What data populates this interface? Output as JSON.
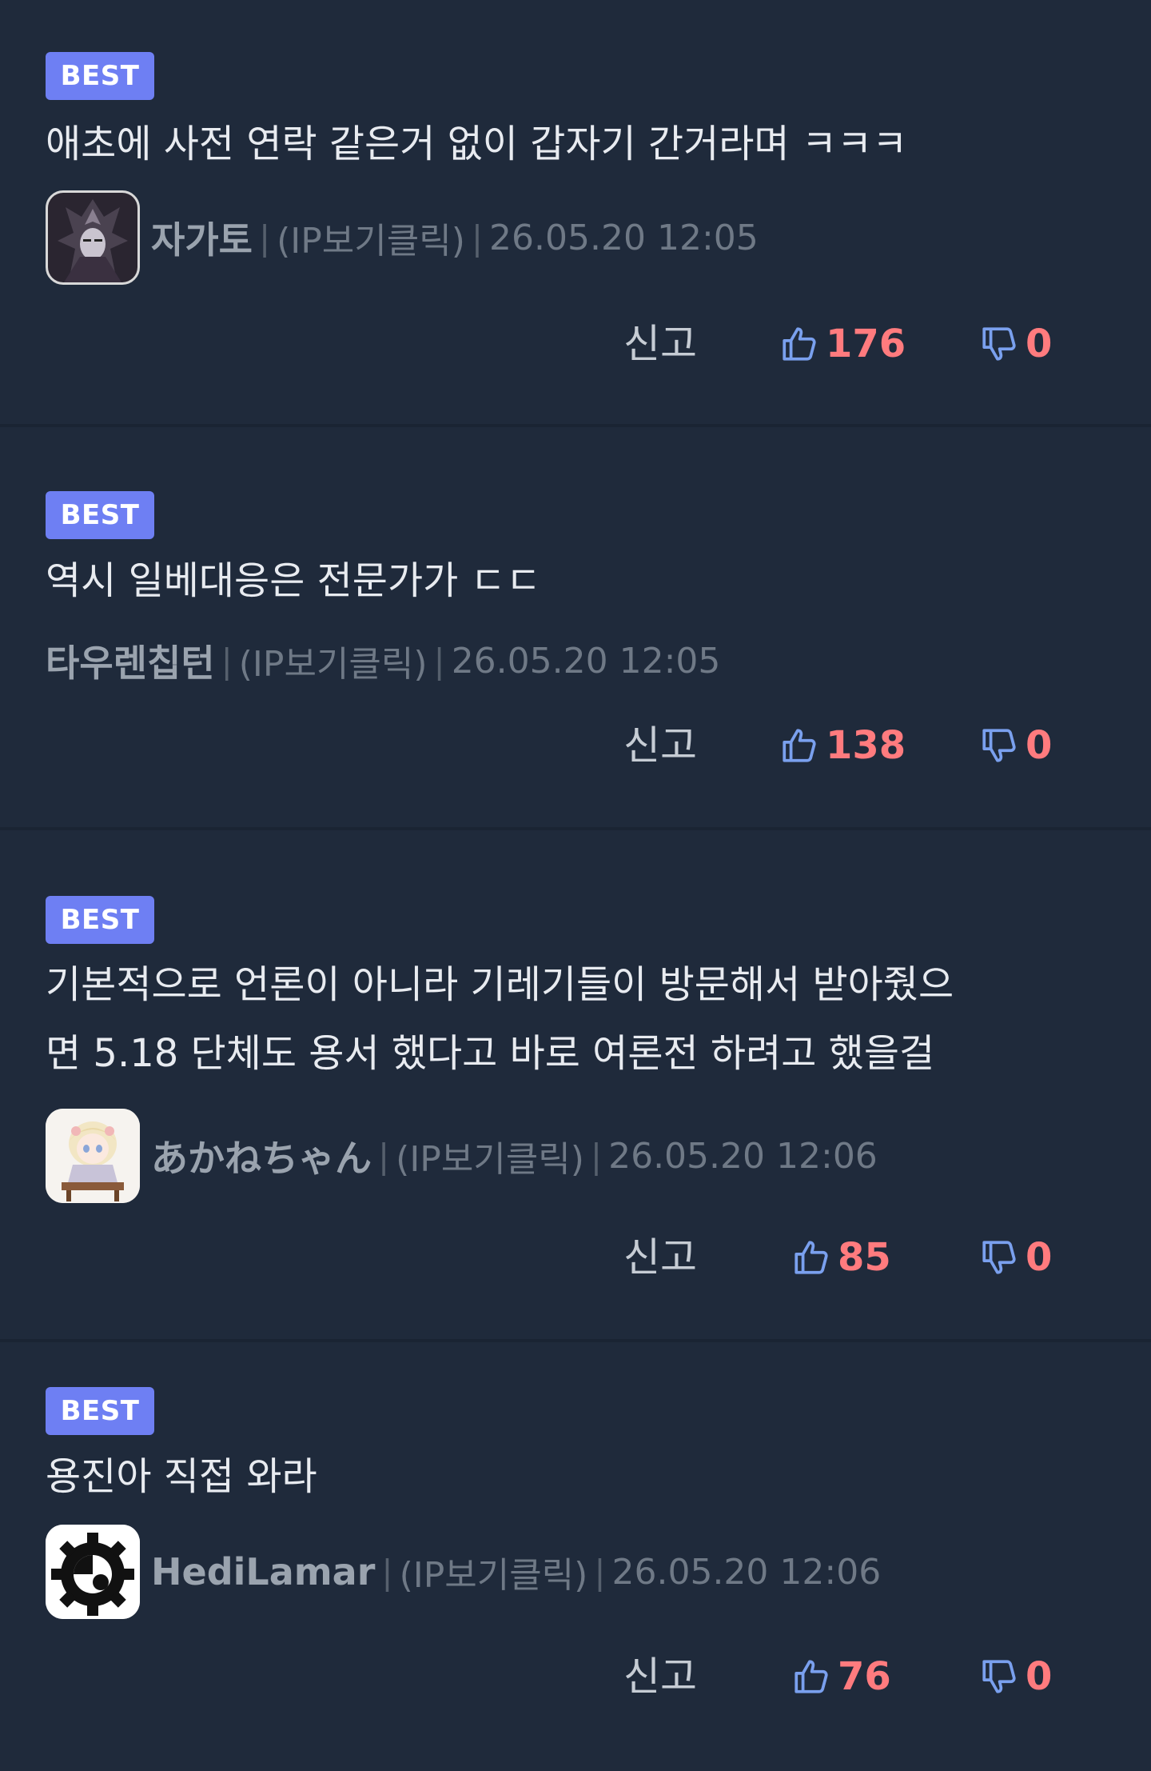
{
  "comments": [
    {
      "badge": "BEST",
      "text": "애초에 사전 연락 같은거 없이 갑자기 간거라며 ㅋㅋㅋ",
      "author": "자가토",
      "ip_link": "(IP보기클릭)",
      "date": "26.05.20 12:05",
      "report_label": "신고",
      "likes": "176",
      "dislikes": "0",
      "avatar_icon": "dark-knight-avatar"
    },
    {
      "badge": "BEST",
      "text": "역시 일베대응은 전문가가 ㄷㄷ",
      "author": "타우렌칩턴",
      "ip_link": "(IP보기클릭)",
      "date": "26.05.20 12:05",
      "report_label": "신고",
      "likes": "138",
      "dislikes": "0",
      "avatar_icon": ""
    },
    {
      "badge": "BEST",
      "text": "기본적으로 언론이 아니라 기레기들이 방문해서 받아줬으\n면 5.18 단체도 용서 했다고 바로 여론전 하려고 했을걸",
      "author": "あかねちゃん",
      "ip_link": "(IP보기클릭)",
      "date": "26.05.20 12:06",
      "report_label": "신고",
      "likes": "85",
      "dislikes": "0",
      "avatar_icon": "anime-girl-avatar"
    },
    {
      "badge": "BEST",
      "text": "용진아 직접 와라",
      "author": "HediLamar",
      "ip_link": "(IP보기클릭)",
      "date": "26.05.20 12:06",
      "report_label": "신고",
      "likes": "76",
      "dislikes": "0",
      "avatar_icon": "gear-avatar"
    }
  ],
  "colors": {
    "background": "#1f2a3b",
    "badge": "#6e7ff3",
    "vote_count": "#ff7b7e",
    "thumb_icon": "#7aa0ee"
  }
}
